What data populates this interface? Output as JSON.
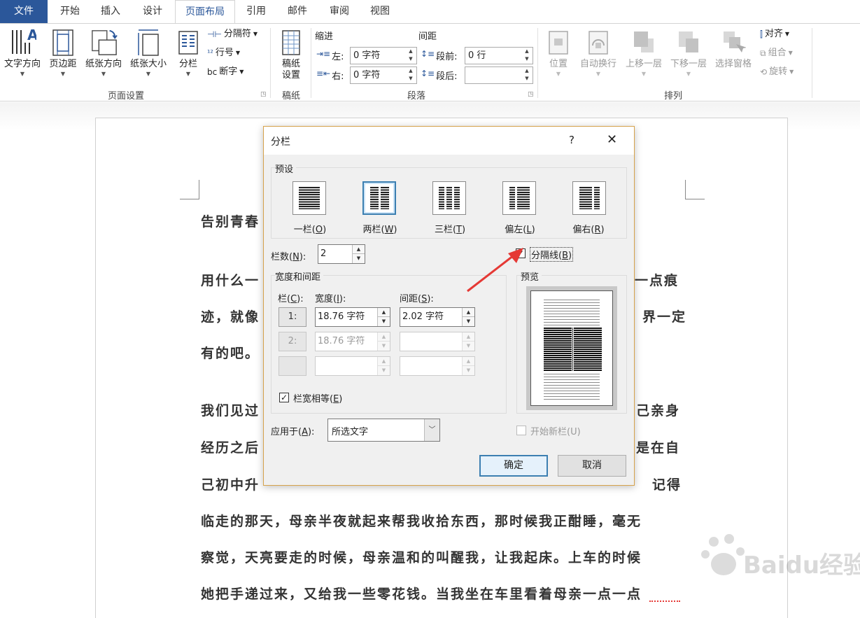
{
  "tabs": [
    {
      "label": "文件"
    },
    {
      "label": "开始"
    },
    {
      "label": "插入"
    },
    {
      "label": "设计"
    },
    {
      "label": "页面布局"
    },
    {
      "label": "引用"
    },
    {
      "label": "邮件"
    },
    {
      "label": "审阅"
    },
    {
      "label": "视图"
    }
  ],
  "ribbon": {
    "page_setup": {
      "text_direction": "文字方向",
      "margins": "页边距",
      "orientation": "纸张方向",
      "size": "纸张大小",
      "columns": "分栏",
      "breaks": "分隔符",
      "line_numbers": "行号",
      "hyphenation": "断字",
      "group_label": "页面设置"
    },
    "draft": {
      "button": "稿纸\n设置",
      "group_label": "稿纸"
    },
    "paragraph": {
      "indent_label": "缩进",
      "spacing_label": "间距",
      "left_label": "左:",
      "left_value": "0 字符",
      "right_label": "右:",
      "right_value": "0 字符",
      "before_label": "段前:",
      "before_value": "0 行",
      "after_label": "段后:",
      "after_value": "",
      "group_label": "段落"
    },
    "arrange": {
      "position": "位置",
      "wrap_text": "自动换行",
      "bring_forward": "上移一层",
      "send_backward": "下移一层",
      "selection_pane": "选择窗格",
      "align": "对齐",
      "group": "组合",
      "rotate": "旋转",
      "group_label": "排列"
    }
  },
  "document": {
    "lines": [
      "告别青春",
      "用什么一",
      "一点痕",
      "迹，就像",
      "界一定",
      "有的吧。",
      "我们见过",
      "己亲身",
      "经历之后",
      "是在自",
      "己初中升",
      "记得",
      "临走的那天，母亲半夜就起来帮我收拾东西，那时候我正酣睡，毫无",
      "察觉，天亮要走的时候，母亲温和的叫醒我，让我起床。上车的时候",
      "她把手递过来，又给我一些零花钱。当我坐在车里看着母亲一点一点"
    ]
  },
  "dialog": {
    "title": "分栏",
    "help": "?",
    "close": "✕",
    "presets_label": "预设",
    "presets": [
      {
        "label": "一栏(",
        "key": "O",
        "end": ")"
      },
      {
        "label": "两栏(",
        "key": "W",
        "end": ")"
      },
      {
        "label": "三栏(",
        "key": "T",
        "end": ")"
      },
      {
        "label": "偏左(",
        "key": "L",
        "end": ")"
      },
      {
        "label": "偏右(",
        "key": "R",
        "end": ")"
      }
    ],
    "num_columns_label": "栏数(",
    "num_columns_key": "N",
    "num_columns_end": "):",
    "num_columns_value": "2",
    "line_between_label": "分隔线(",
    "line_between_key": "B",
    "line_between_end": ")",
    "width_spacing_label": "宽度和间距",
    "col_header": "栏(",
    "col_header_key": "C",
    "col_header_end": "):",
    "width_header": "宽度(",
    "width_header_key": "I",
    "width_header_end": "):",
    "spacing_header": "间距(",
    "spacing_header_key": "S",
    "spacing_header_end": "):",
    "rows": [
      {
        "num": "1:",
        "width": "18.76 字符",
        "spacing": "2.02 字符"
      },
      {
        "num": "2:",
        "width": "18.76 字符",
        "spacing": ""
      },
      {
        "num": "",
        "width": "",
        "spacing": ""
      }
    ],
    "equal_width_label": "栏宽相等(",
    "equal_width_key": "E",
    "equal_width_end": ")",
    "apply_to_label": "应用于(",
    "apply_to_key": "A",
    "apply_to_end": "):",
    "apply_to_value": "所选文字",
    "preview_label": "预览",
    "start_new_column_label": "开始新栏(U)",
    "ok": "确定",
    "cancel": "取消"
  },
  "watermark": "Baidu经验 jingyan.baidu.com",
  "colors": {
    "file_tab": "#2b579a",
    "dialog_border": "#d6a24b",
    "annotation_arrow": "#e53935",
    "primary_button_border": "#3c7fb1"
  }
}
